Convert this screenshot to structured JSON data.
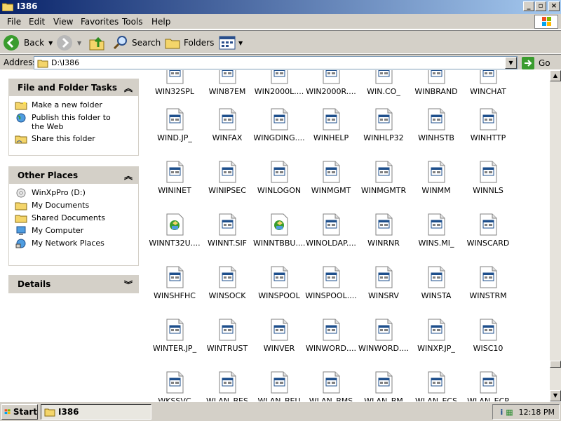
{
  "window": {
    "title": "I386"
  },
  "menu": [
    "File",
    "Edit",
    "View",
    "Favorites",
    "Tools",
    "Help"
  ],
  "toolbar": {
    "back": "Back",
    "search": "Search",
    "folders": "Folders"
  },
  "address": {
    "label": "Address",
    "value": "D:\\I386",
    "go": "Go"
  },
  "tasks": {
    "file_folder": {
      "title": "File and Folder Tasks",
      "items": [
        "Make a new folder",
        "Publish this folder to the Web",
        "Share this folder"
      ]
    },
    "other_places": {
      "title": "Other Places",
      "items": [
        "WinXpPro (D:)",
        "My Documents",
        "Shared Documents",
        "My Computer",
        "My Network Places"
      ]
    },
    "details": {
      "title": "Details"
    }
  },
  "files": [
    [
      "WIN32SPL",
      "WIN87EM",
      "WIN2000L....",
      "WIN2000R....",
      "WIN.CO_",
      "WINBRAND",
      "WINCHAT"
    ],
    [
      "WIND.JP_",
      "WINFAX",
      "WINGDING....",
      "WINHELP",
      "WINHLP32",
      "WINHSTB",
      "WINHTTP"
    ],
    [
      "WININET",
      "WINIPSEC",
      "WINLOGON",
      "WINMGMT",
      "WINMGMTR",
      "WINMM",
      "WINNLS"
    ],
    [
      "WINNT32U....",
      "WINNT.SIF",
      "WINNTBBU....",
      "WINOLDAP....",
      "WINRNR",
      "WINS.MI_",
      "WINSCARD"
    ],
    [
      "WINSHFHC",
      "WINSOCK",
      "WINSPOOL",
      "WINSPOOL....",
      "WINSRV",
      "WINSTA",
      "WINSTRM"
    ],
    [
      "WINTER.JP_",
      "WINTRUST",
      "WINVER",
      "WINWORD....",
      "WINWORD....",
      "WINXP.JP_",
      "WISC10"
    ],
    [
      "WKSSVC",
      "WLAN_BES",
      "WLAN_BEU",
      "WLAN_BMS",
      "WLAN_BM",
      "WLAN_ECS",
      "WLAN_ECP"
    ]
  ],
  "setup_icons": [
    "WINNT32U....",
    "WINNTBBU...."
  ],
  "taskbar": {
    "start": "Start",
    "window": "I386",
    "clock": "12:18 PM"
  }
}
